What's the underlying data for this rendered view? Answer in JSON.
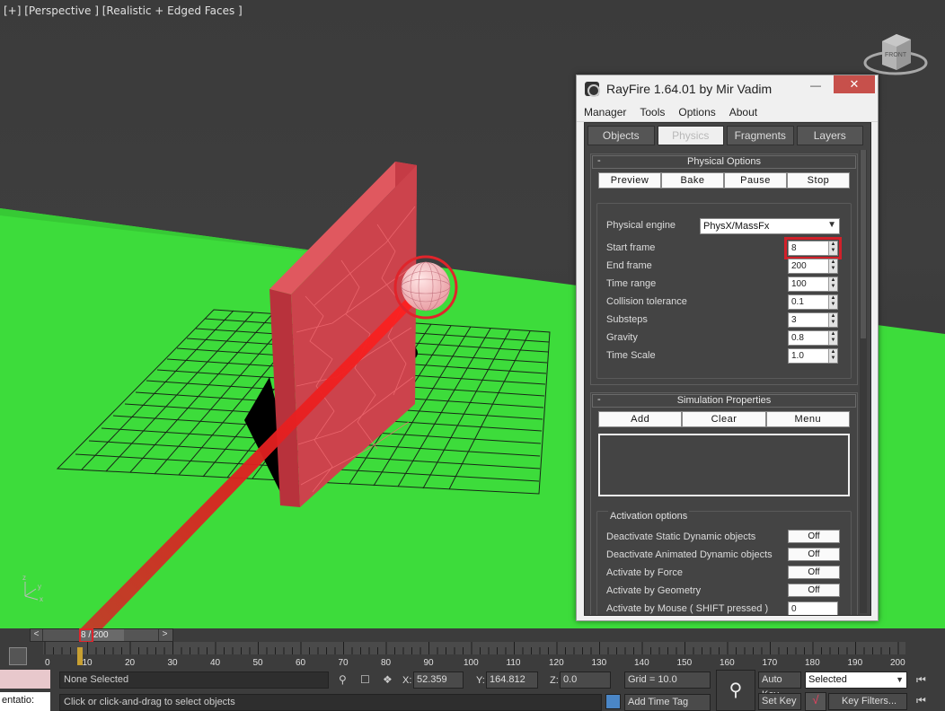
{
  "viewport": {
    "label": "[+] [Perspective ] [Realistic + Edged Faces ]",
    "viewcube_face": "FRONT",
    "axis_labels": {
      "x": "x",
      "y": "y",
      "z": "z"
    }
  },
  "rayfire": {
    "title": "RayFire 1.64.01  by Mir Vadim",
    "window_controls": {
      "minimize": "—",
      "maximize": "☐",
      "close": "✕"
    },
    "menu": [
      "Manager",
      "Tools",
      "Options",
      "About"
    ],
    "tabs": [
      {
        "label": "Objects",
        "active": false
      },
      {
        "label": "Physics",
        "active": true
      },
      {
        "label": "Fragments",
        "active": false
      },
      {
        "label": "Layers",
        "active": false
      }
    ],
    "physical_options": {
      "title": "Physical Options",
      "toggle": "-",
      "buttons": [
        "Preview",
        "Bake",
        "Pause",
        "Stop"
      ],
      "engine": {
        "label": "Physical engine",
        "value": "PhysX/MassFx"
      },
      "params": [
        {
          "label": "Start frame",
          "value": "8",
          "highlighted": true
        },
        {
          "label": "End frame",
          "value": "200"
        },
        {
          "label": "Time range",
          "value": "100"
        },
        {
          "label": "Collision tolerance",
          "value": "0.1"
        },
        {
          "label": "Substeps",
          "value": "3"
        },
        {
          "label": "Gravity",
          "value": "0.8"
        },
        {
          "label": "Time Scale",
          "value": "1.0"
        }
      ]
    },
    "simulation_properties": {
      "title": "Simulation Properties",
      "toggle": "-",
      "buttons": [
        "Add",
        "Clear",
        "Menu"
      ]
    },
    "activation_options": {
      "title": "Activation options",
      "items": [
        {
          "label": "Deactivate Static Dynamic objects",
          "value": "Off"
        },
        {
          "label": "Deactivate Animated Dynamic objects",
          "value": "Off"
        },
        {
          "label": "Activate by Force",
          "value": "Off"
        },
        {
          "label": "Activate by Geometry",
          "value": "Off"
        },
        {
          "label": "Activate by Mouse ( SHIFT pressed )",
          "value": "0"
        }
      ]
    }
  },
  "timeline": {
    "slider_label": "8 / 200",
    "current_frame": 8,
    "frame_count": 200,
    "arrows": {
      "left": "<",
      "right": ">"
    },
    "ticks": [
      "0",
      "10",
      "20",
      "30",
      "40",
      "50",
      "60",
      "70",
      "80",
      "90",
      "100",
      "110",
      "120",
      "130",
      "140",
      "150",
      "160",
      "170",
      "180",
      "190",
      "200"
    ]
  },
  "status": {
    "selection": "None Selected",
    "prompt": "Click or click-and-drag to select objects",
    "left_field": "entatio:",
    "coords": {
      "x_label": "X:",
      "x": "52.359",
      "y_label": "Y:",
      "y": "164.812",
      "z_label": "Z:",
      "z": "0.0"
    },
    "grid": "Grid = 10.0",
    "add_time_tag": "Add Time Tag",
    "auto_key": "Auto Key",
    "set_key": "Set Key",
    "selected_value": "Selected",
    "key_filters": "Key Filters..."
  },
  "colors": {
    "ground": "#3ce03c",
    "wall": "#d2454e",
    "highlight": "#e0242b",
    "dialog_bg": "#444444"
  }
}
